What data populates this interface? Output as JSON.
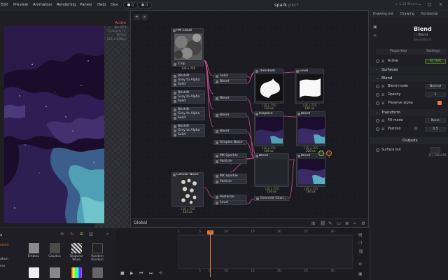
{
  "menubar": {
    "items": [
      "Edit",
      "Preview",
      "Animation",
      "Rendering",
      "Panels",
      "Help",
      "Dev"
    ],
    "badge_left": "0",
    "badge_right": "0",
    "title": "spark",
    "title_ext": ".pxc*",
    "version": "v. 1.18 Steam",
    "tab_labels": [
      "Drawing ext",
      "Drawing",
      "Horizontal"
    ]
  },
  "preview": {
    "status": "Active",
    "info": [
      "fps 120",
      "Frame 0 / 1",
      "40 ms",
      "128 x 256px"
    ]
  },
  "graph": {
    "footer_label": "Global",
    "nodes": {
      "rm_cloud": {
        "title": "RM Cloud"
      },
      "crop": {
        "title": "Crop",
        "size": "128 x 256"
      },
      "bi1": [
        "Bitshift",
        "Grey to Alpha",
        "Solid"
      ],
      "bi2": [
        "Bitshift",
        "Grey to Alpha",
        "Solid"
      ],
      "bi3": [
        "Bitshift",
        "Grey to Alpha",
        "Solid"
      ],
      "bi4": [
        "Bitshift",
        "Grey to Alpha",
        "Solid"
      ],
      "solid_blend_1": [
        "Solid",
        "Blend"
      ],
      "blend_2": "Blend",
      "blend_3": "Blend",
      "blend_4": "Blend",
      "simplex": "Simplex Noise",
      "threshold": {
        "title": "Threshold",
        "size": "128 x 256",
        "time": "110 us"
      },
      "level": {
        "title": "Level",
        "size": "128 x 256",
        "time": "140 us"
      },
      "displace": {
        "title": "Displace",
        "size": "128 x 256",
        "time": "140 us"
      },
      "blend_mid": {
        "title": "Blend",
        "size": "128 x 256",
        "time": "220 us"
      },
      "mk_sparkle_1": [
        "MK Sparkle",
        "Particle"
      ],
      "blend_lower": {
        "title": "Blend",
        "size": "128 x 256",
        "time": "150 us"
      },
      "blend_right": {
        "title": "Blend",
        "size": "128 x 256",
        "time": "100 us"
      },
      "cellular": {
        "title": "Cellular Noise",
        "size": "128 x 256",
        "time": "120 us"
      },
      "mk_sparkle_2": [
        "MK Sparkle",
        "Particle"
      ],
      "posterize": [
        "Posterize",
        "Level"
      ],
      "override": "Override Chan..."
    }
  },
  "inspector": {
    "tabs": [
      "Properties",
      "Settings"
    ],
    "title": "Blend",
    "subtitle": "Blend",
    "subtitle2": "Blend/Blend",
    "active_label": "Active",
    "active_value": "ACTIVE",
    "sections": {
      "surfaces": "Surfaces",
      "blend": "Blend",
      "transform": "Transform",
      "outputs": "Outputs"
    },
    "blend_mode_label": "Blend mode",
    "blend_mode_value": "Normal",
    "opacity_label": "Opacity",
    "opacity_value": "1",
    "preserve_label": "Preserve alpha",
    "fill_label": "Fill mode",
    "fill_value": "None",
    "position_label": "Position",
    "position_value": "0.5",
    "surface_out_label": "Surface out",
    "surface_out_value": "[1] 128x256"
  },
  "assets": {
    "section_left": [
      "a",
      "arted",
      "ation",
      "ear"
    ],
    "items": [
      "Emboss",
      "Caustics",
      "Diagonal Wave",
      "Random Random"
    ]
  },
  "timeline": {
    "ticks": [
      "1",
      "5",
      "10",
      "15",
      "20",
      "25",
      "30"
    ],
    "frame": "0",
    "bottom_ticks": [
      "5",
      "6",
      "10",
      "15",
      "20",
      "25",
      "30"
    ]
  },
  "colors": {
    "accent": "#e6733f",
    "port": "#c94f8f",
    "active_green": "#7ac74f",
    "preserve_orange": "#e67a3f"
  }
}
